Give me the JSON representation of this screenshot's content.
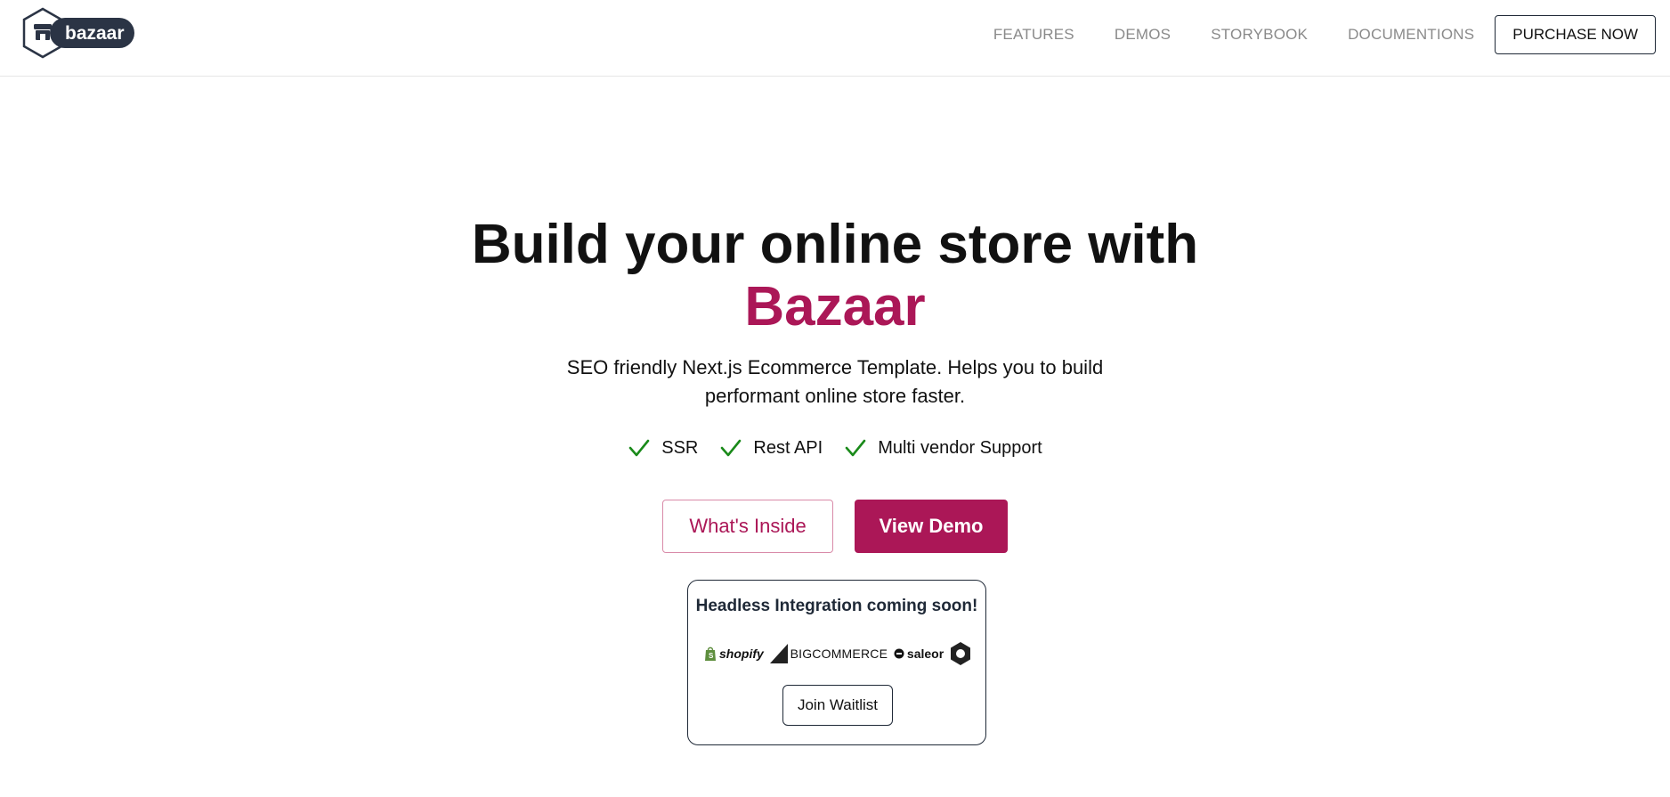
{
  "logo": {
    "text": "bazaar",
    "icon": "storefront-hexagon-icon",
    "colors": {
      "dark": "#2b3445",
      "badge_text": "#ffffff"
    }
  },
  "nav": {
    "items": [
      {
        "label": "FEATURES"
      },
      {
        "label": "DEMOS"
      },
      {
        "label": "STORYBOOK"
      },
      {
        "label": "DOCUMENTIONS"
      }
    ],
    "purchase_label": "PURCHASE NOW"
  },
  "hero": {
    "title_line1": "Build your online store with",
    "title_line2": "Bazaar",
    "subtitle_line1": "SEO friendly Next.js Ecommerce Template. Helps you to build",
    "subtitle_line2": "performant online store faster.",
    "features": [
      {
        "label": "SSR",
        "icon": "check-icon"
      },
      {
        "label": "Rest API",
        "icon": "check-icon"
      },
      {
        "label": "Multi vendor Support",
        "icon": "check-icon"
      }
    ],
    "buttons": {
      "secondary": "What's Inside",
      "primary": "View Demo"
    }
  },
  "headless": {
    "title": "Headless Integration coming soon!",
    "brands": [
      {
        "name": "shopify",
        "icon": "shopify-bag-icon"
      },
      {
        "name": "BIGCOMMERCE",
        "icon": "bigcommerce-triangle-icon"
      },
      {
        "name": "saleor",
        "icon": "saleor-circle-icon"
      },
      {
        "name": "",
        "icon": "hexagon-logo-icon"
      }
    ],
    "waitlist_label": "Join Waitlist"
  },
  "colors": {
    "accent": "#ab1757",
    "check": "#1a8a1a",
    "text": "#111111",
    "muted": "#8a8a8a",
    "border": "#1f2937"
  }
}
